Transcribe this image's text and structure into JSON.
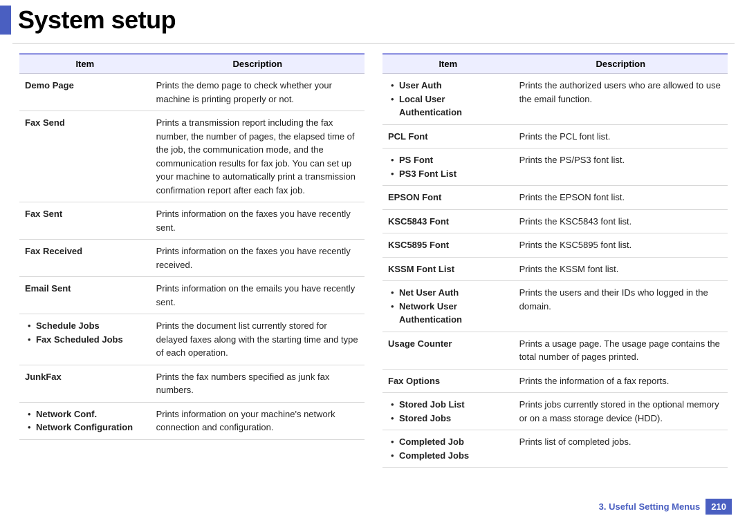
{
  "title": "System setup",
  "headers": {
    "item": "Item",
    "description": "Description"
  },
  "left_rows": [
    {
      "items": [
        "Demo Page"
      ],
      "bulleted": false,
      "desc": "Prints the demo page to check whether your machine is printing properly or not."
    },
    {
      "items": [
        "Fax Send"
      ],
      "bulleted": false,
      "desc": "Prints a transmission report including the fax number, the number of pages, the elapsed time of the job, the communication mode, and the communication results for fax job. You can set up your machine to automatically print a transmission confirmation report after each fax job."
    },
    {
      "items": [
        "Fax Sent"
      ],
      "bulleted": false,
      "desc": "Prints information on the faxes you have recently sent."
    },
    {
      "items": [
        "Fax Received"
      ],
      "bulleted": false,
      "desc": "Prints information on the faxes you have recently received."
    },
    {
      "items": [
        "Email Sent"
      ],
      "bulleted": false,
      "desc": "Prints information on the emails you have recently sent."
    },
    {
      "items": [
        "Schedule Jobs",
        "Fax Scheduled Jobs"
      ],
      "bulleted": true,
      "desc": "Prints the document list currently stored for delayed faxes along with the starting time and type of each operation."
    },
    {
      "items": [
        "JunkFax"
      ],
      "bulleted": false,
      "desc": "Prints the fax numbers specified as junk fax numbers."
    },
    {
      "items": [
        "Network Conf.",
        "Network Configuration"
      ],
      "bulleted": true,
      "desc": "Prints information on your machine's network connection and configuration."
    }
  ],
  "right_rows": [
    {
      "items": [
        "User Auth",
        "Local User Authentication"
      ],
      "bulleted": true,
      "desc": "Prints the authorized users who are allowed to use the email function."
    },
    {
      "items": [
        "PCL Font"
      ],
      "bulleted": false,
      "desc": "Prints the PCL font list."
    },
    {
      "items": [
        "PS Font",
        "PS3 Font List"
      ],
      "bulleted": true,
      "desc": "Prints the PS/PS3 font list."
    },
    {
      "items": [
        "EPSON Font"
      ],
      "bulleted": false,
      "desc": "Prints the EPSON font list."
    },
    {
      "items": [
        "KSC5843 Font"
      ],
      "bulleted": false,
      "desc": "Prints the KSC5843 font list."
    },
    {
      "items": [
        "KSC5895 Font"
      ],
      "bulleted": false,
      "desc": "Prints the KSC5895 font list."
    },
    {
      "items": [
        "KSSM Font List"
      ],
      "bulleted": false,
      "desc": "Prints the KSSM font list."
    },
    {
      "items": [
        "Net User Auth",
        "Network User Authentication"
      ],
      "bulleted": true,
      "desc": "Prints the users and their IDs who logged in the domain."
    },
    {
      "items": [
        "Usage Counter"
      ],
      "bulleted": false,
      "desc": "Prints a usage page. The usage page contains the total number of pages printed."
    },
    {
      "items": [
        "Fax Options"
      ],
      "bulleted": false,
      "desc": "Prints the information of a fax reports."
    },
    {
      "items": [
        "Stored Job List",
        "Stored Jobs"
      ],
      "bulleted": true,
      "desc": "Prints jobs currently stored in the optional memory or on a mass storage device (HDD)."
    },
    {
      "items": [
        "Completed Job",
        "Completed Jobs"
      ],
      "bulleted": true,
      "desc": "Prints list of completed jobs."
    }
  ],
  "footer": {
    "chapter": "3.  Useful Setting Menus",
    "page": "210"
  }
}
